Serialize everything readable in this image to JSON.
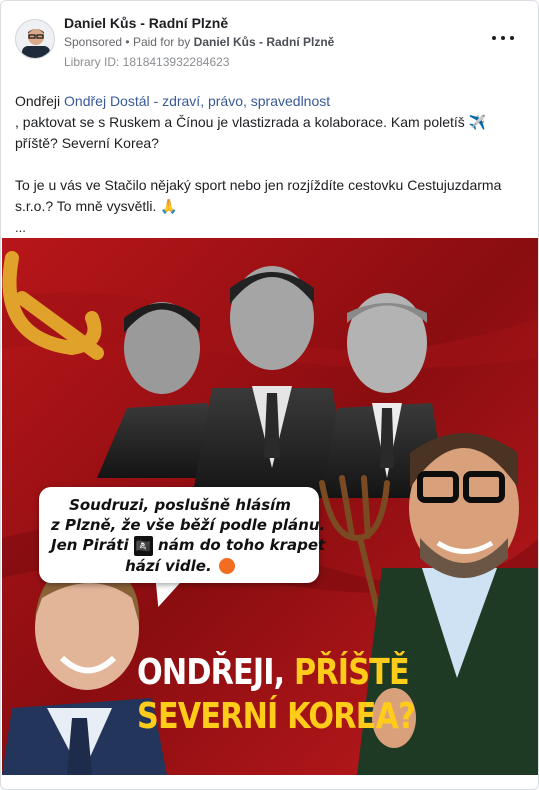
{
  "ad": {
    "page_name": "Daniel Kůs - Radní Plzně",
    "sponsored_label": "Sponsored",
    "paid_for_prefix": "Paid for by",
    "paid_for_name": "Daniel Kůs - Radní Plzně",
    "library_id": "Library ID: 1818413932284623",
    "more_icon": "more-horizontal-icon"
  },
  "post": {
    "greeting": "Ondřeji",
    "mention": "Ondřej Dostál - zdraví, právo, spravedlnost",
    "line1": ", paktovat se s Ruskem a Čínou je vlastizrada a kolaborace. Kam poletíš ✈️ příště? Severní Korea?",
    "line2": "To je u vás ve Stačilo nějaký sport nebo jen rozjíždíte cestovku Cestujuzdarma s.r.o.? To mně vysvětli. 🙏",
    "ellipsis": "..."
  },
  "creative": {
    "bubble_line1": "Soudruzi, poslušně hlásím",
    "bubble_line2": "z Plzně, že vše běží podle plánu.",
    "bubble_line3a": "Jen Piráti",
    "bubble_flag": "🏴‍☠️",
    "bubble_line3b": "nám do toho krapet",
    "bubble_line4": "hází vidle.",
    "headline_white": "ONDŘEJI,",
    "headline_yellow_1": "PŘÍŠTĚ",
    "headline_yellow_2": "SEVERNÍ KOREA?",
    "colors": {
      "background_red": "#8f0f12",
      "headline_yellow": "#ffcc1a",
      "mention_blue": "#385898"
    }
  }
}
